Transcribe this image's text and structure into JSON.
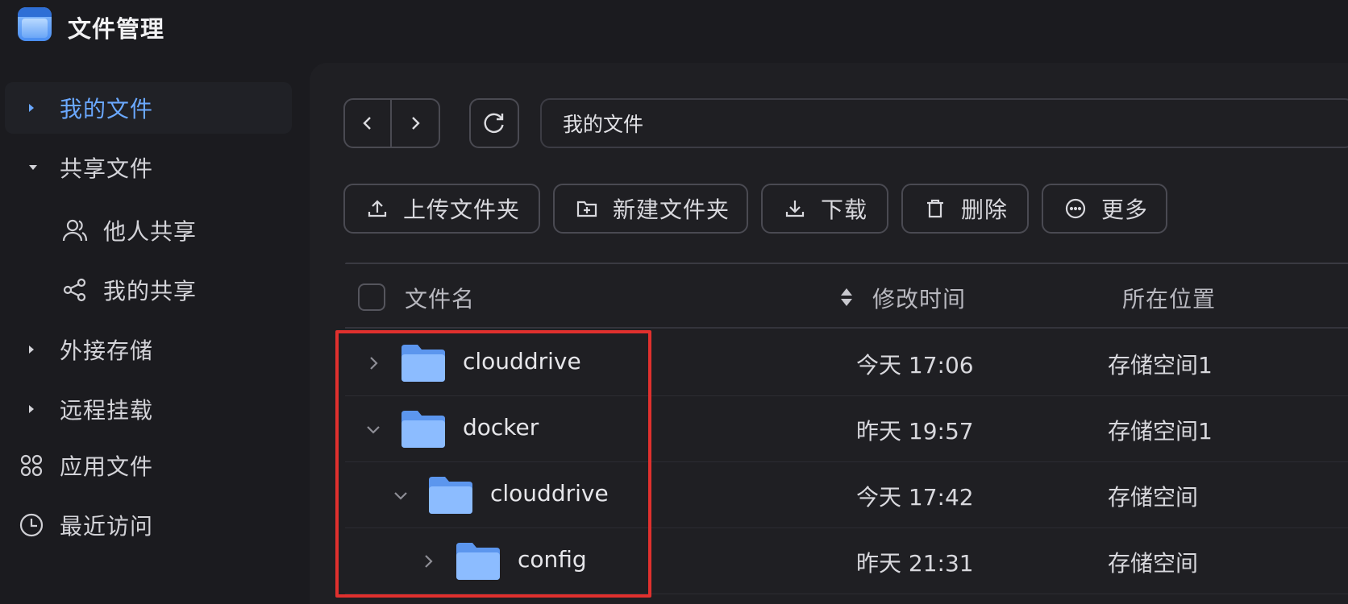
{
  "app": {
    "title": "文件管理"
  },
  "sidebar": {
    "items": [
      {
        "label": "我的文件",
        "state": "collapsed",
        "active": true
      },
      {
        "label": "共享文件",
        "state": "expanded",
        "active": false
      },
      {
        "label": "他人共享",
        "icon": "users-icon",
        "child": true
      },
      {
        "label": "我的共享",
        "icon": "share-icon",
        "child": true
      },
      {
        "label": "外接存储",
        "state": "collapsed"
      },
      {
        "label": "远程挂载",
        "state": "collapsed"
      },
      {
        "label": "应用文件",
        "icon": "apps-icon"
      },
      {
        "label": "最近访问",
        "icon": "clock-icon"
      }
    ]
  },
  "path": {
    "current": "我的文件"
  },
  "toolbar": {
    "upload": "上传文件夹",
    "new_folder": "新建文件夹",
    "download": "下载",
    "delete": "删除",
    "more": "更多"
  },
  "table": {
    "columns": {
      "name": "文件名",
      "modified": "修改时间",
      "location": "所在位置"
    },
    "rows": [
      {
        "name": "clouddrive",
        "modified": "今天 17:06",
        "location": "存储空间1",
        "level": 0,
        "expanded": false
      },
      {
        "name": "docker",
        "modified": "昨天 19:57",
        "location": "存储空间1",
        "level": 0,
        "expanded": true
      },
      {
        "name": "clouddrive",
        "modified": "今天 17:42",
        "location": "存储空间",
        "level": 1,
        "expanded": true
      },
      {
        "name": "config",
        "modified": "昨天 21:31",
        "location": "存储空间",
        "level": 2,
        "expanded": false
      }
    ]
  },
  "colors": {
    "accent": "#6aa8ff",
    "highlight": "#e0302e",
    "folder": "#7fb4ff"
  }
}
